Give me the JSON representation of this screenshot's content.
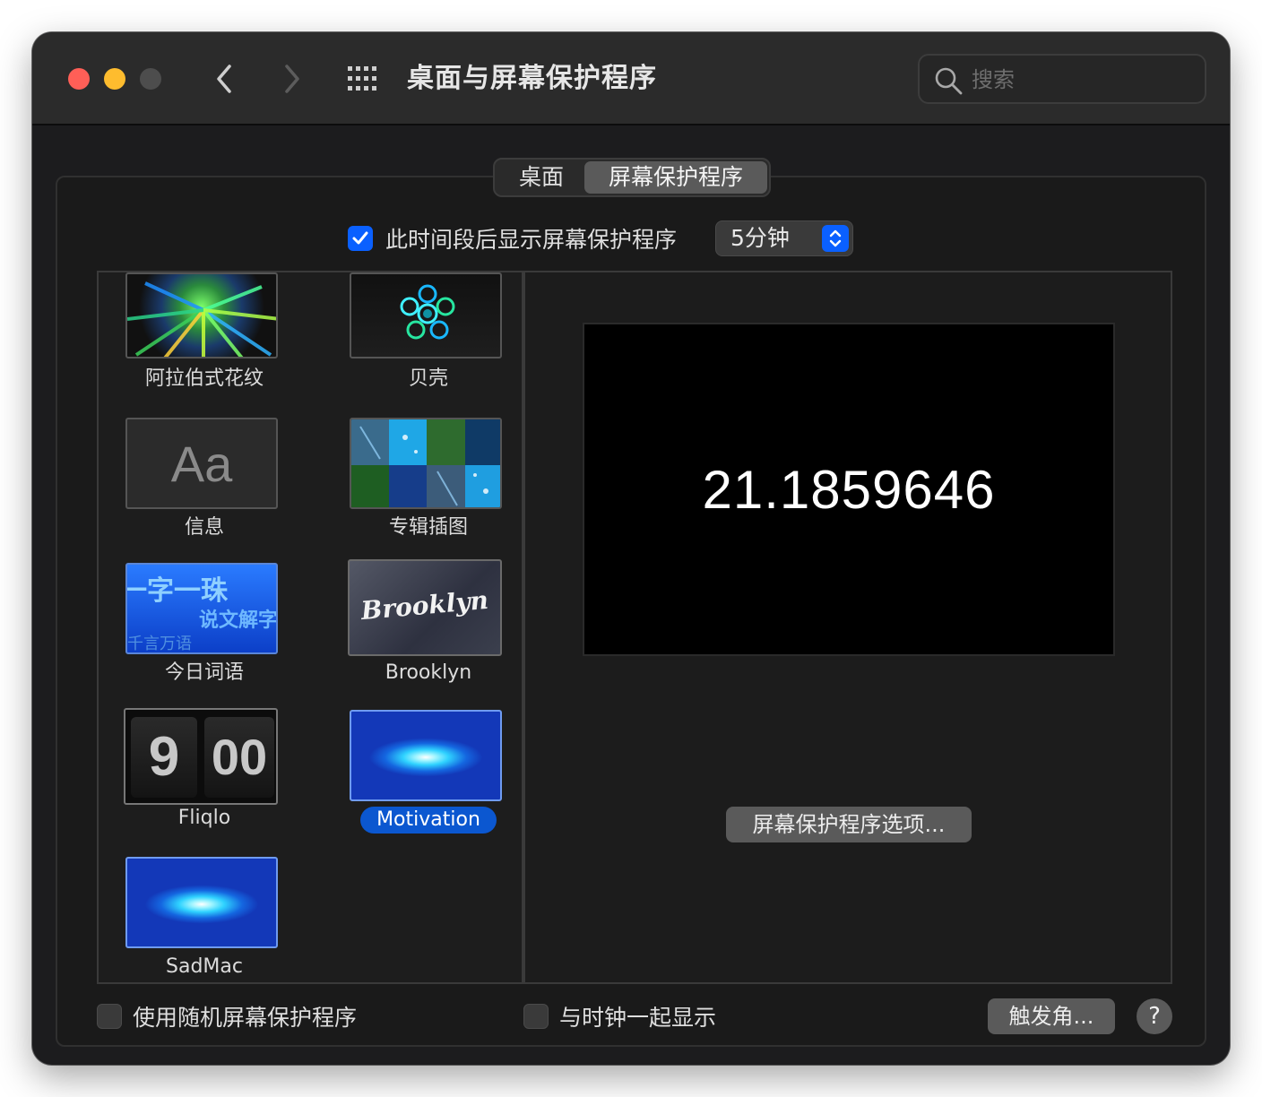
{
  "window": {
    "title": "桌面与屏幕保护程序",
    "search_placeholder": "搜索"
  },
  "tabs": [
    {
      "label": "桌面",
      "selected": false
    },
    {
      "label": "屏幕保护程序",
      "selected": true
    }
  ],
  "idle": {
    "checked": true,
    "label": "此时间段后显示屏幕保护程序",
    "value": "5分钟"
  },
  "savers": [
    {
      "name": "阿拉伯式花纹",
      "thumb": "arabesque"
    },
    {
      "name": "贝壳",
      "thumb": "shell"
    },
    {
      "name": "信息",
      "thumb": "message",
      "thumb_text": "Aa"
    },
    {
      "name": "专辑插图",
      "thumb": "album-artwork"
    },
    {
      "name": "今日词语",
      "thumb": "word-of-the-day",
      "thumb_text": [
        "一字一珠",
        "说文解字",
        "千言万语"
      ]
    },
    {
      "name": "Brooklyn",
      "thumb": "brooklyn",
      "thumb_text": "Brooklyn"
    },
    {
      "name": "Fliqlo",
      "thumb": "fliqlo",
      "thumb_text": [
        "9",
        "00"
      ]
    },
    {
      "name": "Motivation",
      "thumb": "swirl",
      "selected": true
    },
    {
      "name": "SadMac",
      "thumb": "swirl"
    }
  ],
  "preview": {
    "text": "21.1859646",
    "options_button": "屏幕保护程序选项..."
  },
  "bottom": {
    "random_label": "使用随机屏幕保护程序",
    "random_checked": false,
    "clock_label": "与时钟一起显示",
    "clock_checked": false,
    "hot_corners_button": "触发角...",
    "help_button": "?"
  },
  "colors": {
    "accent": "#0a60ff",
    "selection": "#0b57d0",
    "window_bg": "#1c1c1e"
  }
}
